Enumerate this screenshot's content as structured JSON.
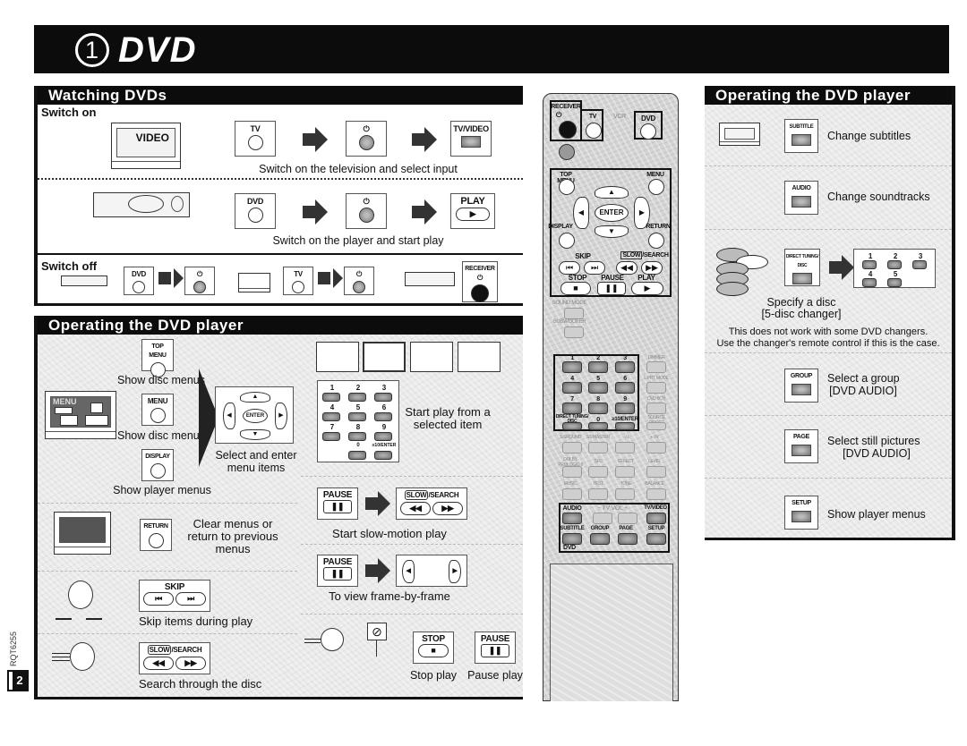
{
  "banner": {
    "number": "1",
    "title": "DVD"
  },
  "side_code": "RQT6255",
  "page_number": "2",
  "watching": {
    "heading": "Watching DVDs",
    "switch_on_label": "Switch on",
    "tv_screen_text": "VIDEO",
    "row1": {
      "buttons": [
        "TV",
        "⏻",
        "TV/VIDEO"
      ],
      "caption": "Switch on the television and select input"
    },
    "row2": {
      "buttons": [
        "DVD",
        "⏻",
        "PLAY"
      ],
      "play_symbol": "▶",
      "caption": "Switch on the player and start play"
    },
    "switch_off_label": "Switch off",
    "off_buttons": [
      "DVD",
      "⏻",
      "TV",
      "⏻",
      "RECEIVER"
    ],
    "receiver_power": "⏻"
  },
  "operating_left": {
    "heading": "Operating the DVD player",
    "menu_screen_text": "MENU",
    "top_menu": {
      "button": "TOP MENU",
      "caption": "Show disc menus"
    },
    "menu": {
      "button": "MENU",
      "caption": "Show disc menus"
    },
    "display": {
      "button": "DISPLAY",
      "caption": "Show player menus"
    },
    "enter_pad": {
      "center": "ENTER",
      "caption": "Select and enter menu items"
    },
    "numpad": {
      "keys": [
        "1",
        "2",
        "3",
        "4",
        "5",
        "6",
        "7",
        "8",
        "9",
        "0",
        "≥10/ENTER"
      ],
      "caption": "Start play from a selected item"
    },
    "return": {
      "button": "RETURN",
      "caption": "Clear menus or return to previous menus"
    },
    "skip": {
      "label": "SKIP",
      "keys": [
        "⏮",
        "⏭"
      ],
      "caption": "Skip items during play"
    },
    "search": {
      "label_slow": "SLOW",
      "label_rest": "/SEARCH",
      "keys": [
        "◀◀",
        "▶▶"
      ],
      "caption": "Search through the disc"
    },
    "slow_motion": {
      "pause_label": "PAUSE",
      "pause_symbol": "❚❚",
      "label_slow": "SLOW",
      "label_rest": "/SEARCH",
      "keys": [
        "◀◀",
        "▶▶"
      ],
      "caption": "Start slow-motion play"
    },
    "frame": {
      "pause_label": "PAUSE",
      "pause_symbol": "❚❚",
      "caption": "To view frame-by-frame"
    },
    "stop": {
      "label": "STOP",
      "symbol": "■",
      "caption": "Stop play"
    },
    "pause": {
      "label": "PAUSE",
      "symbol": "❚❚",
      "caption": "Pause play"
    }
  },
  "remote": {
    "receiver": "RECEIVER",
    "tv": "TV",
    "vcr": "VCR",
    "dvd": "DVD",
    "top_menu": "TOP MENU",
    "menu": "MENU",
    "enter": "ENTER",
    "display": "DISPLAY",
    "return": "RETURN",
    "skip": "SKIP",
    "slow": "SLOW",
    "search": "/SEARCH",
    "stop": "STOP",
    "pause": "PAUSE",
    "play": "PLAY",
    "sound_mode": "SOUND MODE",
    "subwoofer": "SUBWOOFER",
    "digits": [
      "1",
      "2",
      "3",
      "4",
      "5",
      "6",
      "7",
      "8",
      "9"
    ],
    "direct_tuning": "DIRECT TUNING/ DISC",
    "zero": "0",
    "ten_enter": "≥10/ENTER",
    "right_col": [
      "DIMMER",
      "L.PRT MODE",
      "DVD 6CH",
      "SOURCE DIRECT"
    ],
    "row_a": [
      "S.SROUND",
      "SS.MASTER",
      "− / L",
      "+ / R"
    ],
    "row_b": [
      "DOLBY PROLOGIC II",
      "SFC",
      "EFFECT",
      "LEVEL"
    ],
    "row_c": [
      "MUSIC",
      "TEST",
      "TONE",
      "BALANCE"
    ],
    "audio": "AUDIO",
    "tv_vol": "−  TV VOL  +",
    "tv_video": "TV/VIDEO",
    "subtitle": "SUBTITLE",
    "group": "GROUP",
    "page": "PAGE",
    "setup": "SETUP",
    "dvd_label": "DVD"
  },
  "operating_right": {
    "heading": "Operating the DVD player",
    "items": [
      {
        "button": "SUBTITLE",
        "caption": "Change subtitles"
      },
      {
        "button": "AUDIO",
        "caption": "Change soundtracks"
      },
      {
        "button": "DIRECT TUNING/ DISC",
        "caption": "Specify a disc",
        "sub": "[5-disc changer]",
        "disc_keys": [
          "1",
          "2",
          "3",
          "4",
          "5"
        ]
      },
      {
        "button": "GROUP",
        "caption": "Select a group",
        "sub": "[DVD AUDIO]"
      },
      {
        "button": "PAGE",
        "caption": "Select still pictures",
        "sub": "[DVD AUDIO]"
      },
      {
        "button": "SETUP",
        "caption": "Show player menus"
      }
    ],
    "note_line1": "This does not work with some DVD changers.",
    "note_line2": "Use the changer's remote control if this is the case."
  }
}
